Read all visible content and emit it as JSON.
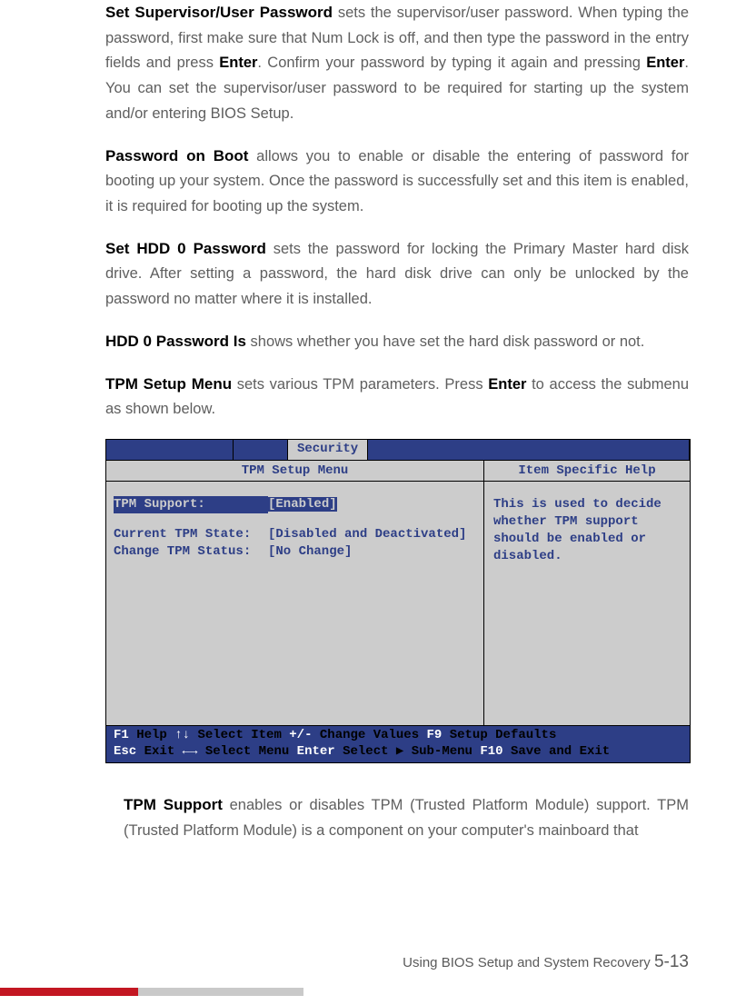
{
  "paragraphs": {
    "p1_head": "Set Supervisor/User Password",
    "p1_a": " sets the supervisor/user password. When typing the password, first make sure that Num Lock is off, and then type the password in the entry fields and press ",
    "p1_enter1": "Enter",
    "p1_b": ". Confirm your password by typing it again and pressing ",
    "p1_enter2": "Enter",
    "p1_c": ". You can set the supervisor/user password to be required for starting up the system and/or entering BIOS Setup.",
    "p2_head": "Password on Boot",
    "p2_a": " allows you to enable or disable the entering of password for booting up your system. Once the password is successfully set and this item is enabled, it is required for booting up the system.",
    "p3_head": "Set HDD 0 Password",
    "p3_a": "  sets the password for locking the Primary Master hard disk drive.  After setting a password, the hard disk drive can only be unlocked by the password no matter where it is installed.",
    "p4_head": "HDD 0 Password Is",
    "p4_a": " shows whether you have set the hard disk password or not.",
    "p5_head": "TPM Setup Menu",
    "p5_a": "  sets various TPM parameters. Press ",
    "p5_enter": "Enter",
    "p5_b": " to access the submenu as shown below.",
    "p6_head": "TPM Support",
    "p6_a": " enables or disables TPM (Trusted Platform Module) support. TPM (Trusted Platform Module) is a component on your computer's mainboard that"
  },
  "bios": {
    "tab_active": "Security",
    "subhead_left": "TPM Setup Menu",
    "subhead_right": "Item Specific Help",
    "rows": {
      "r1_label": "TPM Support:",
      "r1_value": "Enabled",
      "r2_label": "Current TPM State:",
      "r2_value": "[Disabled and Deactivated]",
      "r3_label": "Change TPM Status:",
      "r3_value": "[No Change]"
    },
    "help_text": "This is used to decide whether TPM support should be enabled or disabled.",
    "footer": {
      "f1": "F1",
      "help": " Help  ",
      "arrows_ud": "↑↓",
      "sel_item": " Select Item  ",
      "plusminus": "+/-",
      "chg_val": "   Change Values       ",
      "f9": "F9",
      "setup_def": " Setup Defaults",
      "esc": "Esc",
      "exit": " Exit  ",
      "arrows_lr": "←→",
      "sel_menu": " Select Menu  ",
      "enter": "Enter",
      "sub_menu": " Select ▶ Sub-Menu  ",
      "f10": "F10",
      "save_exit": " Save and Exit"
    }
  },
  "doc_footer": {
    "text": "Using BIOS Setup and System Recovery   ",
    "page": "5-13"
  }
}
